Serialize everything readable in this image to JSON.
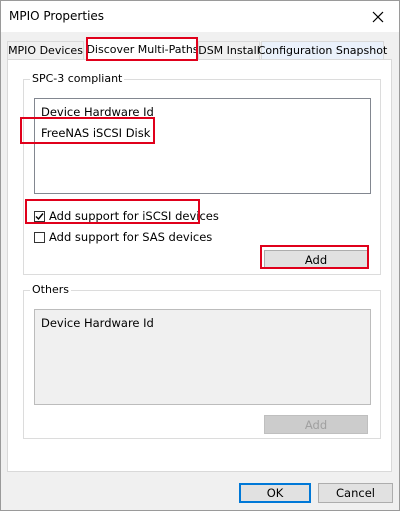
{
  "window": {
    "title": "MPIO Properties"
  },
  "tabs": [
    {
      "label": "MPIO Devices"
    },
    {
      "label": "Discover Multi-Paths"
    },
    {
      "label": "DSM Install"
    },
    {
      "label": "Configuration Snapshot"
    }
  ],
  "spc3": {
    "group_label": "SPC-3 compliant",
    "list_header": "Device Hardware Id",
    "list_items": [
      "FreeNAS iSCSI Disk"
    ],
    "checkbox_iscsi": {
      "label": "Add support for iSCSI devices",
      "checked": true
    },
    "checkbox_sas": {
      "label": "Add support for SAS devices",
      "checked": false
    },
    "add_button": "Add"
  },
  "others": {
    "group_label": "Others",
    "list_header": "Device Hardware Id",
    "add_button": "Add"
  },
  "footer": {
    "ok": "OK",
    "cancel": "Cancel"
  },
  "colors": {
    "highlight": "#e0001b",
    "primary_border": "#0078d7"
  },
  "icons": {
    "close": "close-icon",
    "check": "checkmark-icon"
  }
}
